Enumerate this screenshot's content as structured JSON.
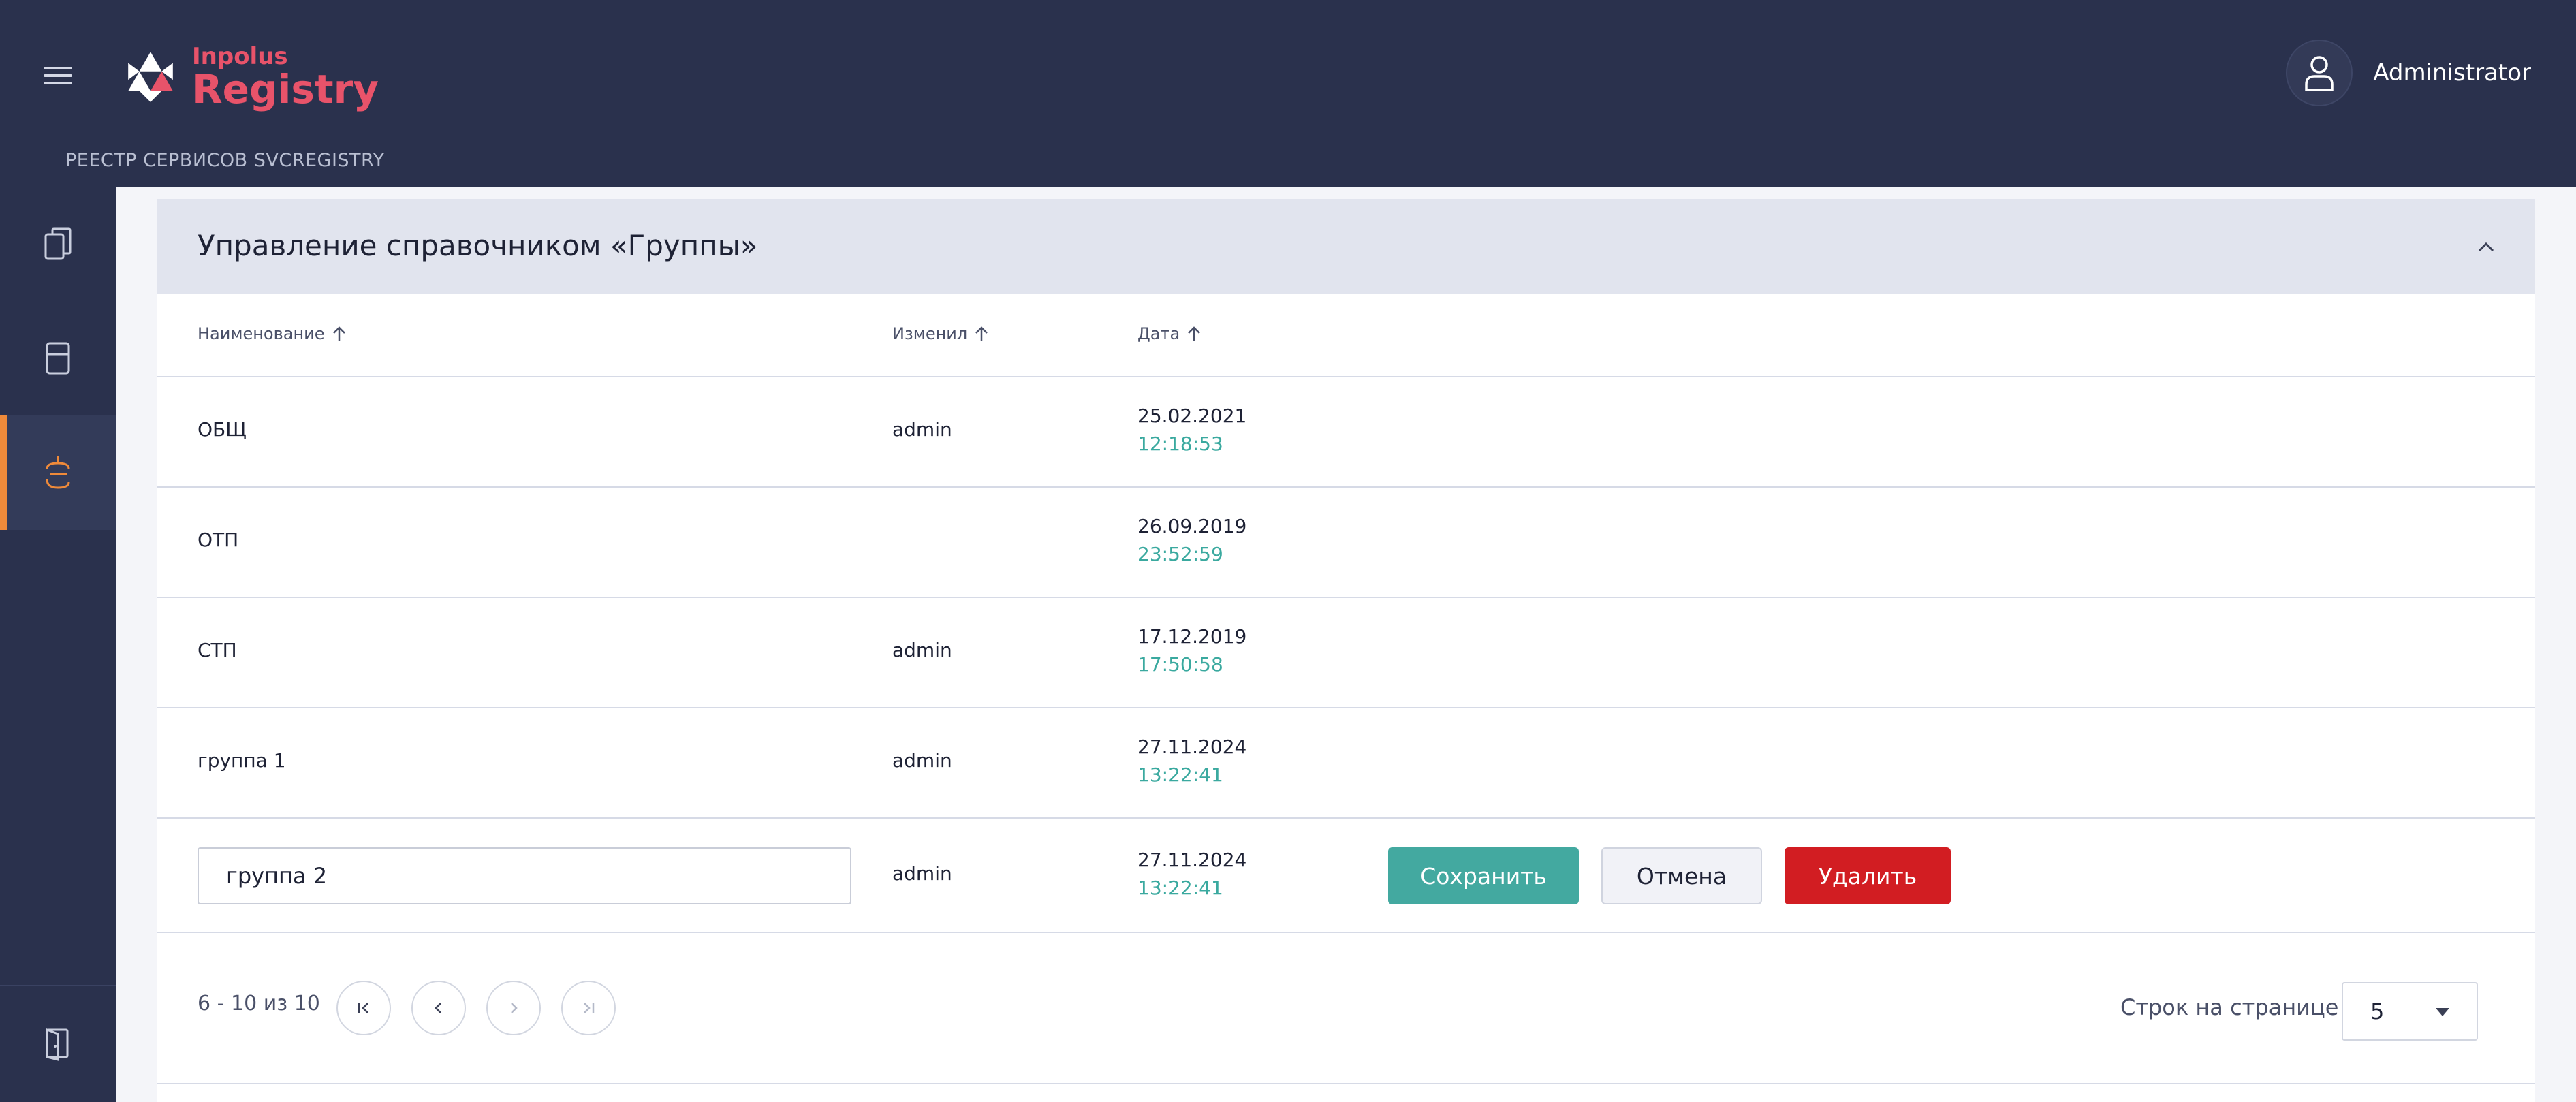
{
  "app": {
    "logo_small": "Inpolus",
    "logo_big": "Registry",
    "subtitle": "РЕЕСТР СЕРВИСОВ SVCREGISTRY",
    "user": "Administrator"
  },
  "colors": {
    "header_bg": "#2a314d",
    "accent_logo": "#e8536a",
    "active_marker": "#ef8a3a",
    "time_text": "#3aa99f",
    "save_button": "#43a9a0",
    "delete_button": "#d21d22"
  },
  "sidebar": {
    "items": [
      {
        "icon": "documents-icon",
        "active": false
      },
      {
        "icon": "server-icon",
        "active": false
      },
      {
        "icon": "registry-icon",
        "active": true
      }
    ],
    "bottom_icon": "logout-door-icon"
  },
  "panel": {
    "title": "Управление справочником «Группы»",
    "columns": [
      "Наименование",
      "Изменил",
      "Дата"
    ],
    "rows": [
      {
        "name": "ОБЩ",
        "changed_by": "admin",
        "date": "25.02.2021",
        "time": "12:18:53"
      },
      {
        "name": "ОТП",
        "changed_by": "",
        "date": "26.09.2019",
        "time": "23:52:59"
      },
      {
        "name": "СТП",
        "changed_by": "admin",
        "date": "17.12.2019",
        "time": "17:50:58"
      },
      {
        "name": "группа 1",
        "changed_by": "admin",
        "date": "27.11.2024",
        "time": "13:22:41"
      }
    ],
    "edit_row": {
      "value": "группа 2",
      "changed_by": "admin",
      "date": "27.11.2024",
      "time": "13:22:41",
      "save_label": "Сохранить",
      "cancel_label": "Отмена",
      "delete_label": "Удалить"
    }
  },
  "pagination": {
    "info": "6 - 10 из 10",
    "rows_label": "Строк на странице",
    "rows_value": "5"
  }
}
